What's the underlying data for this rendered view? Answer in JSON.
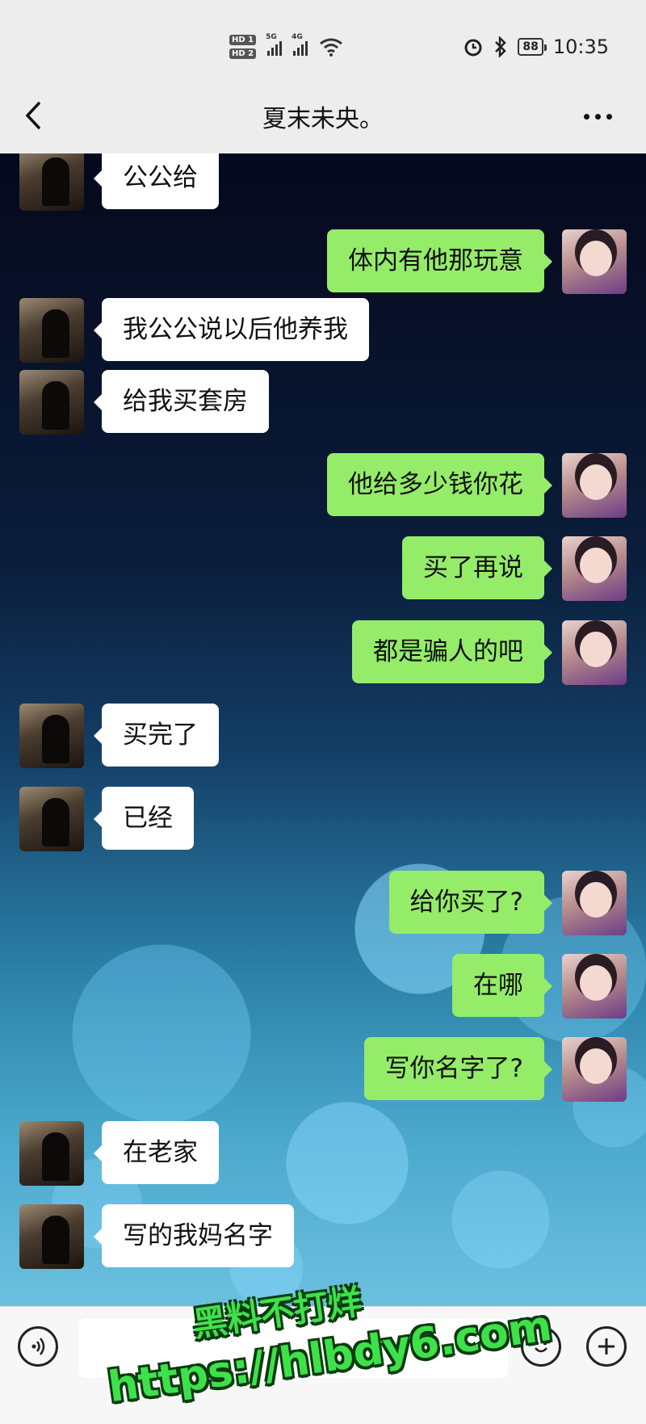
{
  "status_bar": {
    "hd1": "HD 1",
    "hd2": "HD 2",
    "net1": "5G",
    "net2": "4G",
    "battery": "88",
    "time": "10:35"
  },
  "header": {
    "title": "夏末未央。"
  },
  "messages": [
    {
      "side": "them",
      "text": "公公给"
    },
    {
      "side": "me",
      "text": "体内有他那玩意"
    },
    {
      "side": "them",
      "text": "我公公说以后他养我"
    },
    {
      "side": "them",
      "text": "给我买套房"
    },
    {
      "side": "me",
      "text": "他给多少钱你花"
    },
    {
      "side": "me",
      "text": "买了再说"
    },
    {
      "side": "me",
      "text": "都是骗人的吧"
    },
    {
      "side": "them",
      "text": "买完了"
    },
    {
      "side": "them",
      "text": "已经"
    },
    {
      "side": "me",
      "text": "给你买了?"
    },
    {
      "side": "me",
      "text": "在哪"
    },
    {
      "side": "me",
      "text": "写你名字了?"
    },
    {
      "side": "them",
      "text": "在老家"
    },
    {
      "side": "them",
      "text": "写的我妈名字"
    }
  ],
  "input_bar": {
    "icons": [
      "voice-icon",
      "emoji-icon",
      "plus-icon"
    ]
  },
  "watermark": {
    "line1": "黑料不打烊",
    "line2": "https://hlbdy6.com"
  },
  "colors": {
    "my_bubble": "#95ec69",
    "their_bubble": "#ffffff",
    "watermark": "#3fe14a"
  }
}
